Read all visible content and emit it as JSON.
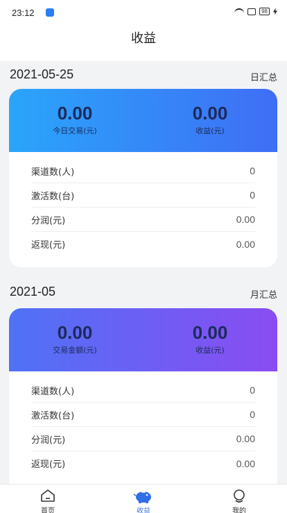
{
  "status_bar": {
    "time": "23:12",
    "battery": "98"
  },
  "header": {
    "title": "收益"
  },
  "sections": [
    {
      "date": "2021-05-25",
      "tag": "日汇总",
      "stats": [
        {
          "value": "0.00",
          "label": "今日交易(元)"
        },
        {
          "value": "0.00",
          "label": "收益(元)"
        }
      ],
      "rows": [
        {
          "label": "渠道数(人)",
          "value": "0"
        },
        {
          "label": "激活数(台)",
          "value": "0"
        },
        {
          "label": "分润(元)",
          "value": "0.00"
        },
        {
          "label": "返现(元)",
          "value": "0.00"
        }
      ]
    },
    {
      "date": "2021-05",
      "tag": "月汇总",
      "stats": [
        {
          "value": "0.00",
          "label": "交易金额(元)"
        },
        {
          "value": "0.00",
          "label": "收益(元)"
        }
      ],
      "rows": [
        {
          "label": "渠道数(人)",
          "value": "0"
        },
        {
          "label": "激活数(台)",
          "value": "0"
        },
        {
          "label": "分润(元)",
          "value": "0.00"
        },
        {
          "label": "返现(元)",
          "value": "0.00"
        }
      ]
    }
  ],
  "tabbar": {
    "items": [
      {
        "label": "首页",
        "icon": "home-icon"
      },
      {
        "label": "收益",
        "icon": "piggy-bank-icon"
      },
      {
        "label": "我的",
        "icon": "profile-icon"
      }
    ],
    "active_color": "#3a73e8"
  }
}
